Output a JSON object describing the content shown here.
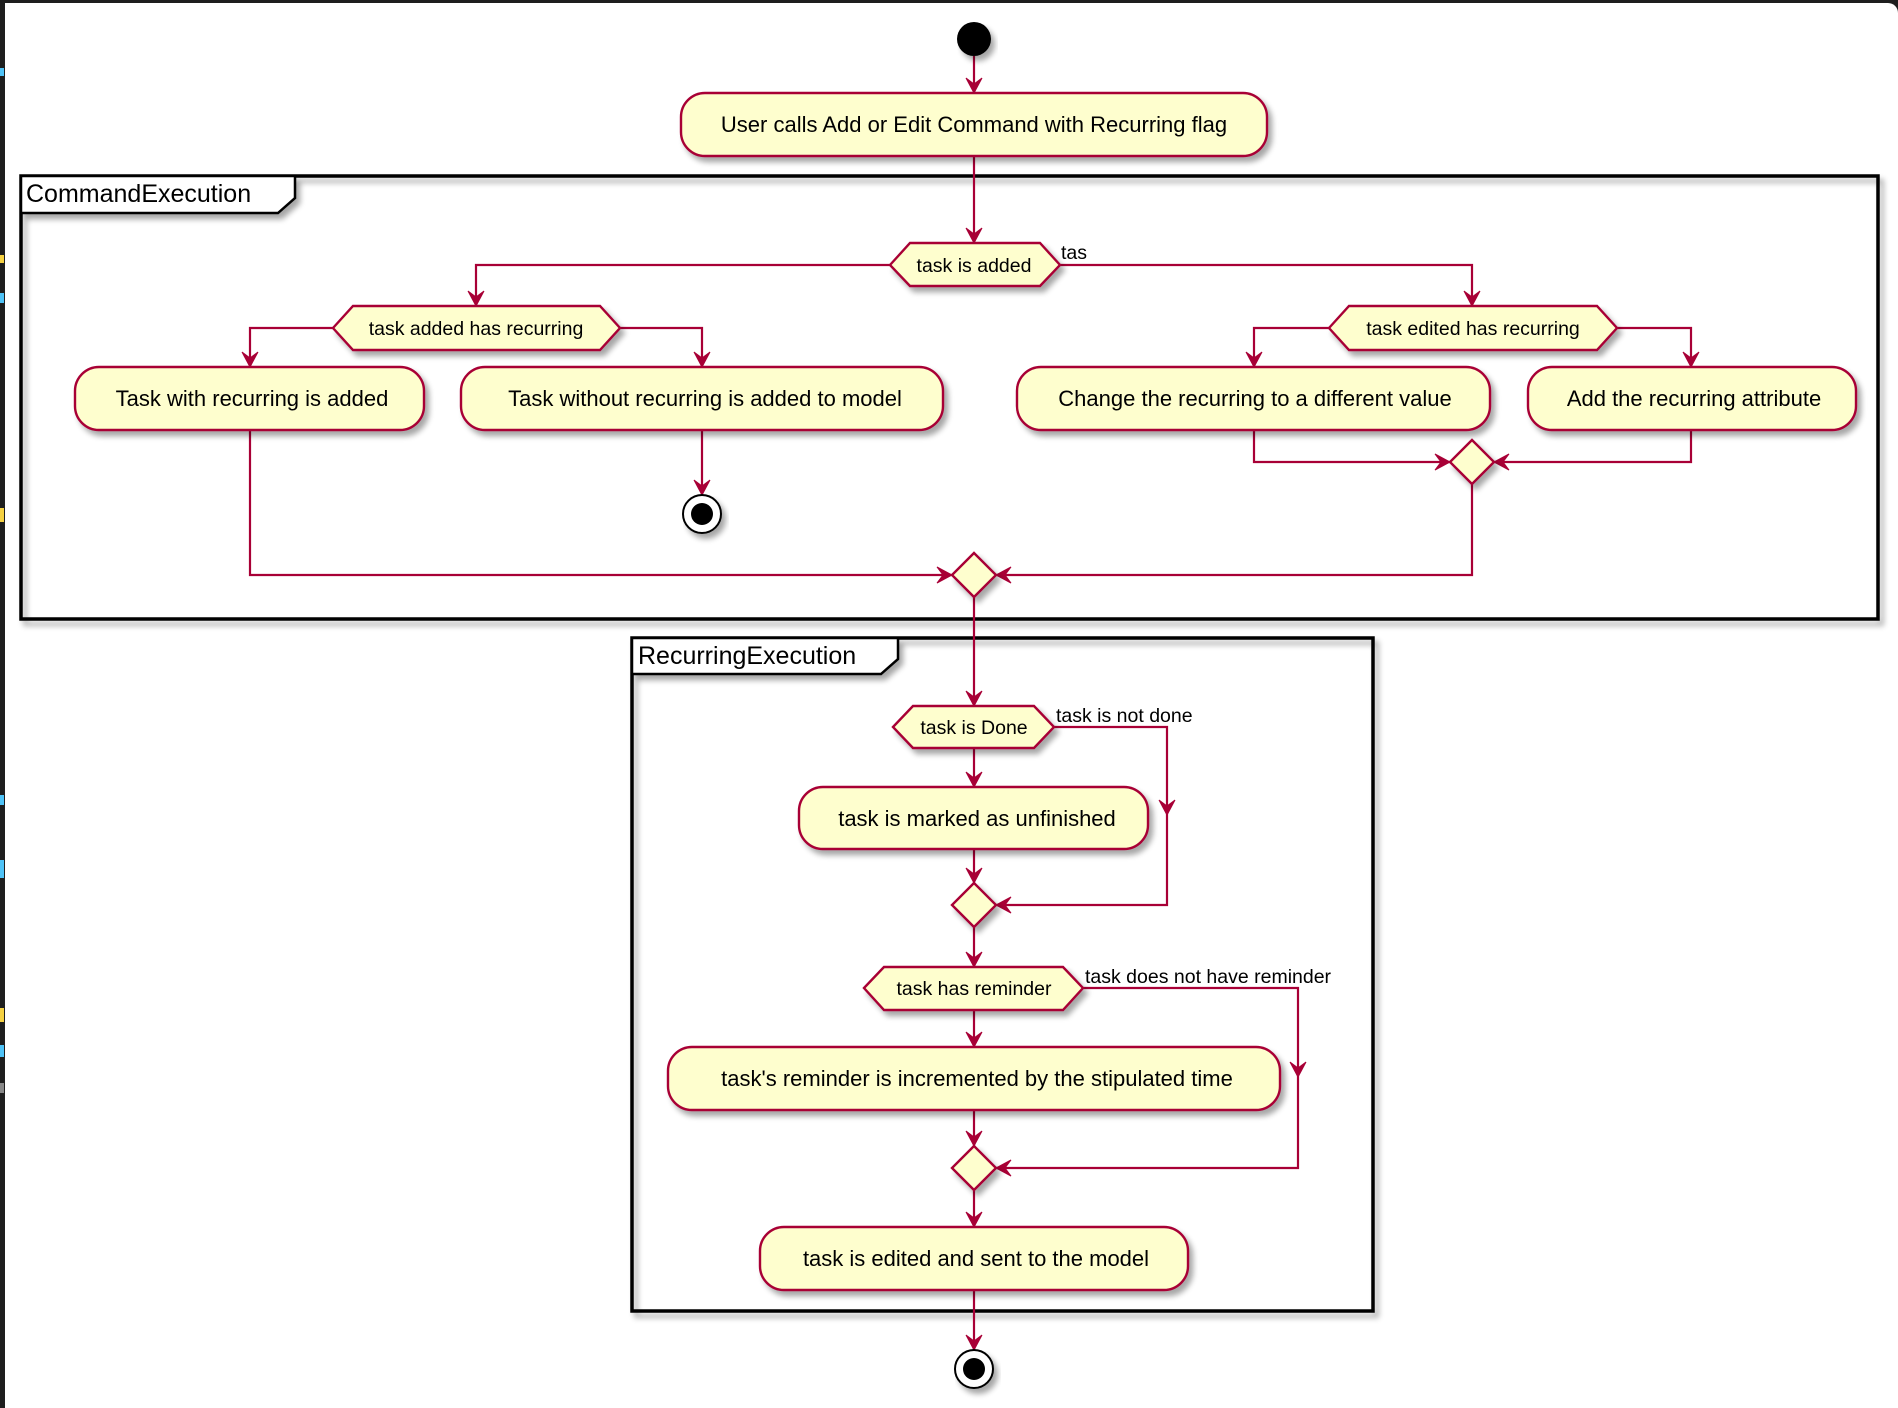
{
  "diagram": {
    "type": "UML activity diagram",
    "colors": {
      "flow": "#a80036",
      "node_fill": "#fefece",
      "frame": "#000000",
      "background": "#ffffff"
    },
    "start": {
      "label": "start"
    },
    "initial_action": "User calls Add or Edit Command with Recurring flag",
    "partitions": {
      "command": {
        "title": "CommandExecution",
        "decision": {
          "label": "task is added",
          "else_label": "tas"
        },
        "added_branch": {
          "decision": "task added has recurring",
          "yes_action": "Task with recurring is added",
          "no_action": "Task without recurring is added to model"
        },
        "edited_branch": {
          "decision": "task edited has recurring",
          "yes_action": "Change the recurring to a different value",
          "no_action": "Add the recurring attribute"
        }
      },
      "recurring": {
        "title": "RecurringExecution",
        "done_decision": {
          "label": "task is Done",
          "else_label": "task is not done"
        },
        "done_action": "task is marked as unfinished",
        "reminder_decision": {
          "label": "task has reminder",
          "else_label": "task does not have reminder"
        },
        "reminder_action": "task's reminder is incremented by the stipulated time",
        "final_action": "task is edited and sent to the model"
      }
    },
    "end": {
      "label": "stop"
    }
  },
  "chrome": {
    "left_strip_marks": [
      "#4fc3f7",
      "#4fc3f7",
      "#f5d142",
      "#4fc3f7",
      "#888888"
    ]
  }
}
